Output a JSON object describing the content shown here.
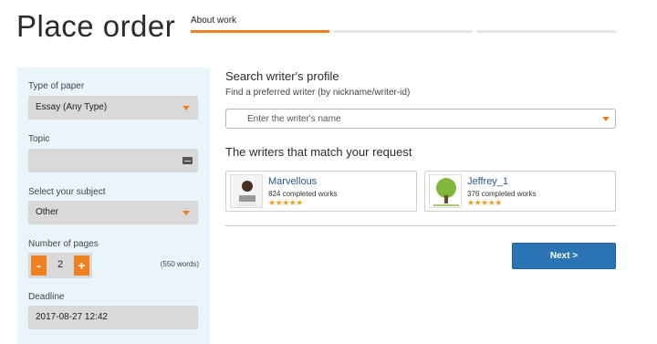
{
  "page_title": "Place order",
  "steps": [
    {
      "label": "About work",
      "active": true
    },
    {
      "label": "",
      "active": false
    },
    {
      "label": "",
      "active": false
    }
  ],
  "sidebar": {
    "paper_type": {
      "label": "Type of paper",
      "value": "Essay (Any Type)"
    },
    "topic": {
      "label": "Topic",
      "value": ""
    },
    "subject": {
      "label": "Select your subject",
      "value": "Other"
    },
    "pages": {
      "label": "Number of pages",
      "value": "2",
      "minus": "-",
      "plus": "+",
      "words_note": "(550 words)"
    },
    "deadline": {
      "label": "Deadline",
      "value": "2017-08-27 12:42"
    }
  },
  "search": {
    "title": "Search writer's profile",
    "subtitle": "Find a preferred writer (by nickname/writer-id)",
    "placeholder": "Enter the writer's name"
  },
  "matches": {
    "title": "The writers that match your request",
    "writers": [
      {
        "name": "Marvellous",
        "works": "824 completed works",
        "stars": "★★★★★",
        "rating": 5
      },
      {
        "name": "Jeffrey_1",
        "works": "376 completed works",
        "stars": "★★★★★",
        "rating": 5
      }
    ]
  },
  "next_button": "Next >",
  "colors": {
    "accent": "#f07f1f",
    "primary": "#2a74b5",
    "link": "#2a5a8c",
    "sidebar_bg": "#e9f4fb",
    "field_bg": "#d9d9d9"
  }
}
